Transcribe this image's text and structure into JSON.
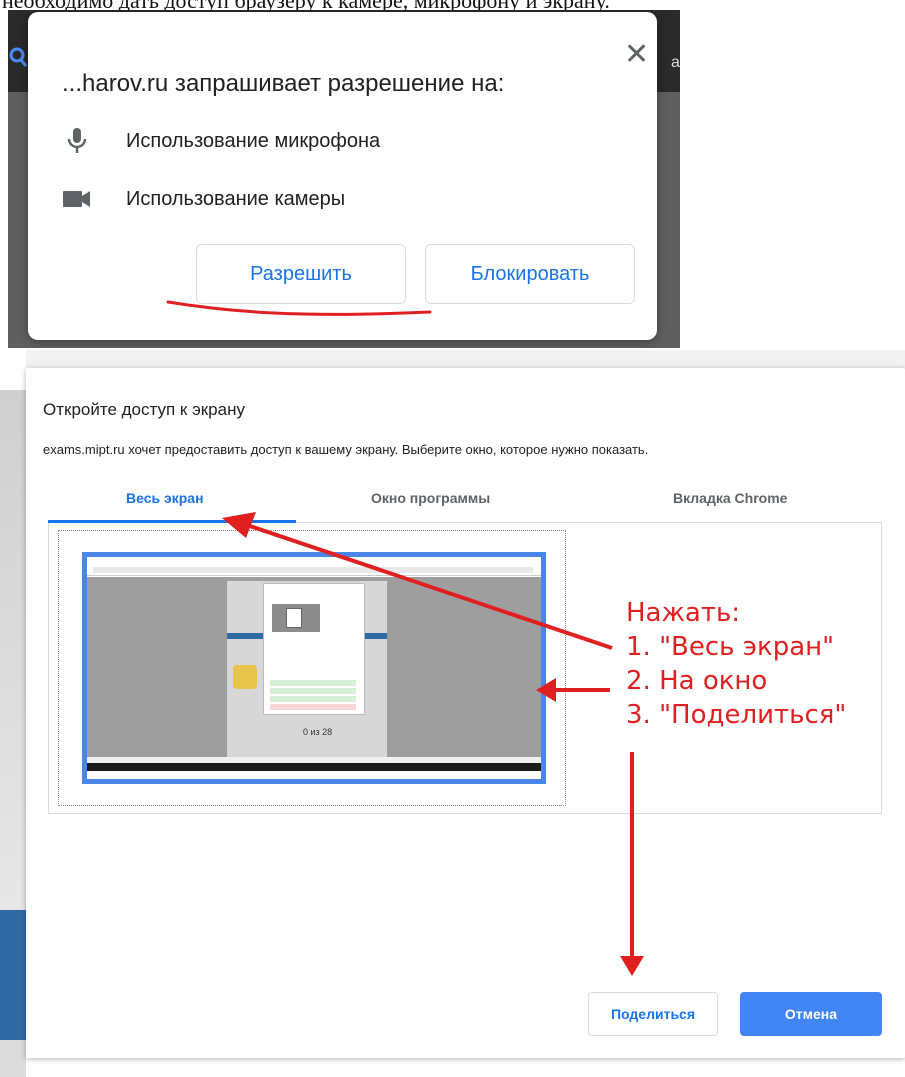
{
  "top_caption": "необходимо дать доступ браузеру к камере, микрофону и экрану.",
  "permission_dialog": {
    "title": "...harov.ru запрашивает разрешение на:",
    "close_glyph": "✕",
    "items": [
      {
        "icon": "microphone-icon",
        "label": "Использование микрофона"
      },
      {
        "icon": "camera-icon",
        "label": "Использование камеры"
      }
    ],
    "allow_label": "Разрешить",
    "block_label": "Блокировать",
    "edge_letter": "а"
  },
  "share_dialog": {
    "title": "Откройте доступ к экрану",
    "description": "exams.mipt.ru хочет предоставить доступ к вашему экрану. Выберите окно, которое нужно показать.",
    "tabs": [
      {
        "label": "Весь экран",
        "active": true
      },
      {
        "label": "Окно программы",
        "active": false
      },
      {
        "label": "Вкладка Chrome",
        "active": false
      }
    ],
    "thumbnail_score": "0 из 28",
    "share_label": "Поделиться",
    "cancel_label": "Отмена"
  },
  "annotation": {
    "color": "#e02020",
    "lines": [
      "Нажать:",
      "1. \"Весь экран\"",
      "2. На окно",
      "3. \"Поделиться\""
    ]
  },
  "colors": {
    "accent": "#1a73e8",
    "button_primary": "#4285f4",
    "highlight_border": "#4a86e8"
  }
}
